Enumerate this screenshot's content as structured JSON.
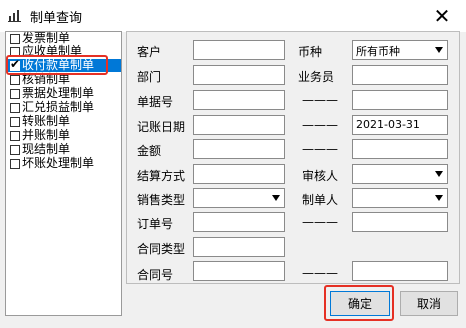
{
  "window": {
    "title": "制单查询",
    "close_glyph": "✕"
  },
  "categories": [
    {
      "label": "发票制单",
      "checked": false,
      "selected": false
    },
    {
      "label": "应收单制单",
      "checked": false,
      "selected": false
    },
    {
      "label": "收付款单制单",
      "checked": true,
      "selected": true
    },
    {
      "label": "核销制单",
      "checked": false,
      "selected": false
    },
    {
      "label": "票据处理制单",
      "checked": false,
      "selected": false
    },
    {
      "label": "汇兑损益制单",
      "checked": false,
      "selected": false
    },
    {
      "label": "转账制单",
      "checked": false,
      "selected": false
    },
    {
      "label": "并账制单",
      "checked": false,
      "selected": false
    },
    {
      "label": "现结制单",
      "checked": false,
      "selected": false
    },
    {
      "label": "坏账处理制单",
      "checked": false,
      "selected": false
    }
  ],
  "form": {
    "customer": {
      "label": "客户",
      "value": ""
    },
    "currency": {
      "label": "币种",
      "value": "所有币种"
    },
    "department": {
      "label": "部门",
      "value": ""
    },
    "salesperson": {
      "label": "业务员",
      "value": ""
    },
    "doc_no": {
      "label": "单据号",
      "value": "",
      "sep": "———",
      "to_value": ""
    },
    "post_date": {
      "label": "记账日期",
      "value": "",
      "sep": "———",
      "to_value": "2021-03-31"
    },
    "amount": {
      "label": "金额",
      "value": "",
      "sep": "———",
      "to_value": ""
    },
    "settlement": {
      "label": "结算方式",
      "value": ""
    },
    "reviewer": {
      "label": "审核人",
      "value": ""
    },
    "sales_type": {
      "label": "销售类型",
      "value": ""
    },
    "maker": {
      "label": "制单人",
      "value": ""
    },
    "order_no": {
      "label": "订单号",
      "value": "",
      "sep": "———",
      "to_value": ""
    },
    "contract_type": {
      "label": "合同类型",
      "value": ""
    },
    "contract_no": {
      "label": "合同号",
      "value": "",
      "sep": "———",
      "to_value": ""
    }
  },
  "buttons": {
    "ok": "确定",
    "cancel": "取消"
  },
  "colors": {
    "selection": "#0078d7",
    "highlight": "#e53024"
  },
  "icons": [
    "app-icon",
    "close-icon",
    "checkbox-icon",
    "dropdown-arrow-icon"
  ]
}
